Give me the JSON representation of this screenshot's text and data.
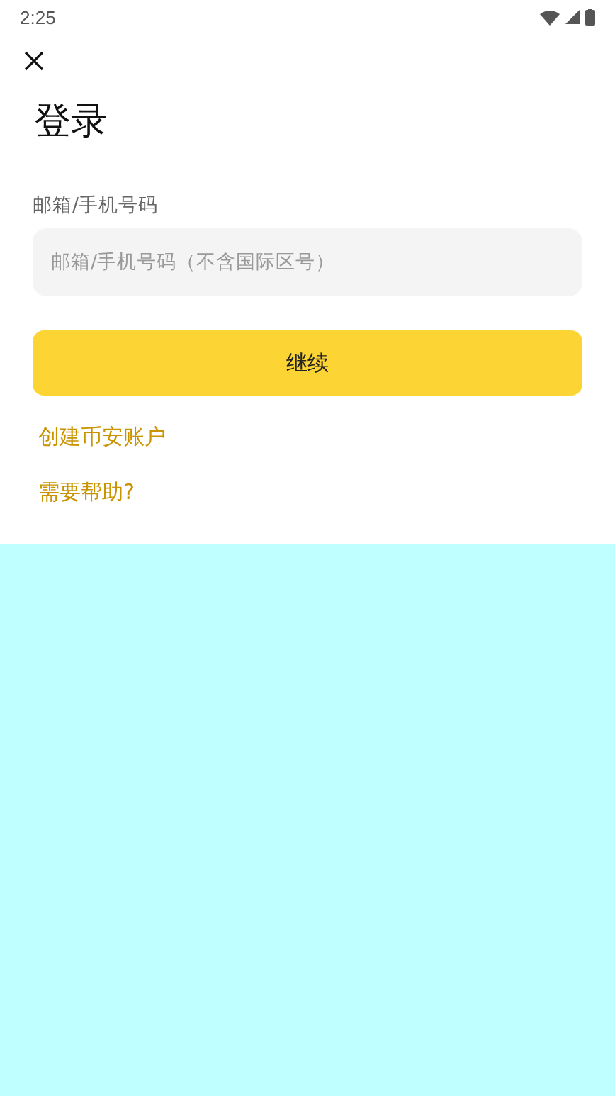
{
  "status_bar": {
    "time": "2:25"
  },
  "title": "登录",
  "field": {
    "label": "邮箱/手机号码",
    "placeholder": "邮箱/手机号码（不含国际区号）"
  },
  "continue_button": "继续",
  "links": [
    "创建币安账户",
    "需要帮助?"
  ]
}
